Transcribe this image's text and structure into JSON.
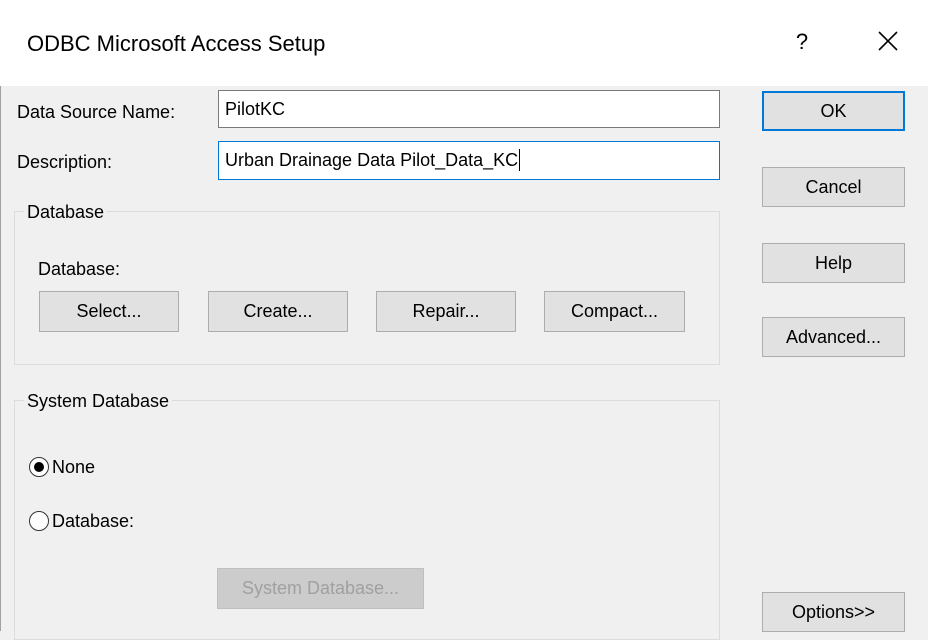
{
  "window": {
    "title": "ODBC Microsoft Access Setup",
    "help_glyph": "?",
    "close_icon": "close-icon"
  },
  "fields": {
    "dsn_label": "Data Source Name:",
    "dsn_value": "PilotKC",
    "description_label": "Description:",
    "description_value": "Urban Drainage Data Pilot_Data_KC"
  },
  "database_group": {
    "caption": "Database",
    "database_label": "Database:",
    "select_label": "Select...",
    "create_label": "Create...",
    "repair_label": "Repair...",
    "compact_label": "Compact..."
  },
  "system_database_group": {
    "caption": "System Database",
    "none_label": "None",
    "database_label": "Database:",
    "selected": "None",
    "system_database_button": "System Database..."
  },
  "side_buttons": {
    "ok": "OK",
    "cancel": "Cancel",
    "help": "Help",
    "advanced": "Advanced...",
    "options": "Options>>"
  },
  "colors": {
    "accent": "#0078d7",
    "face": "#f0f0f0",
    "button": "#e1e1e1"
  }
}
